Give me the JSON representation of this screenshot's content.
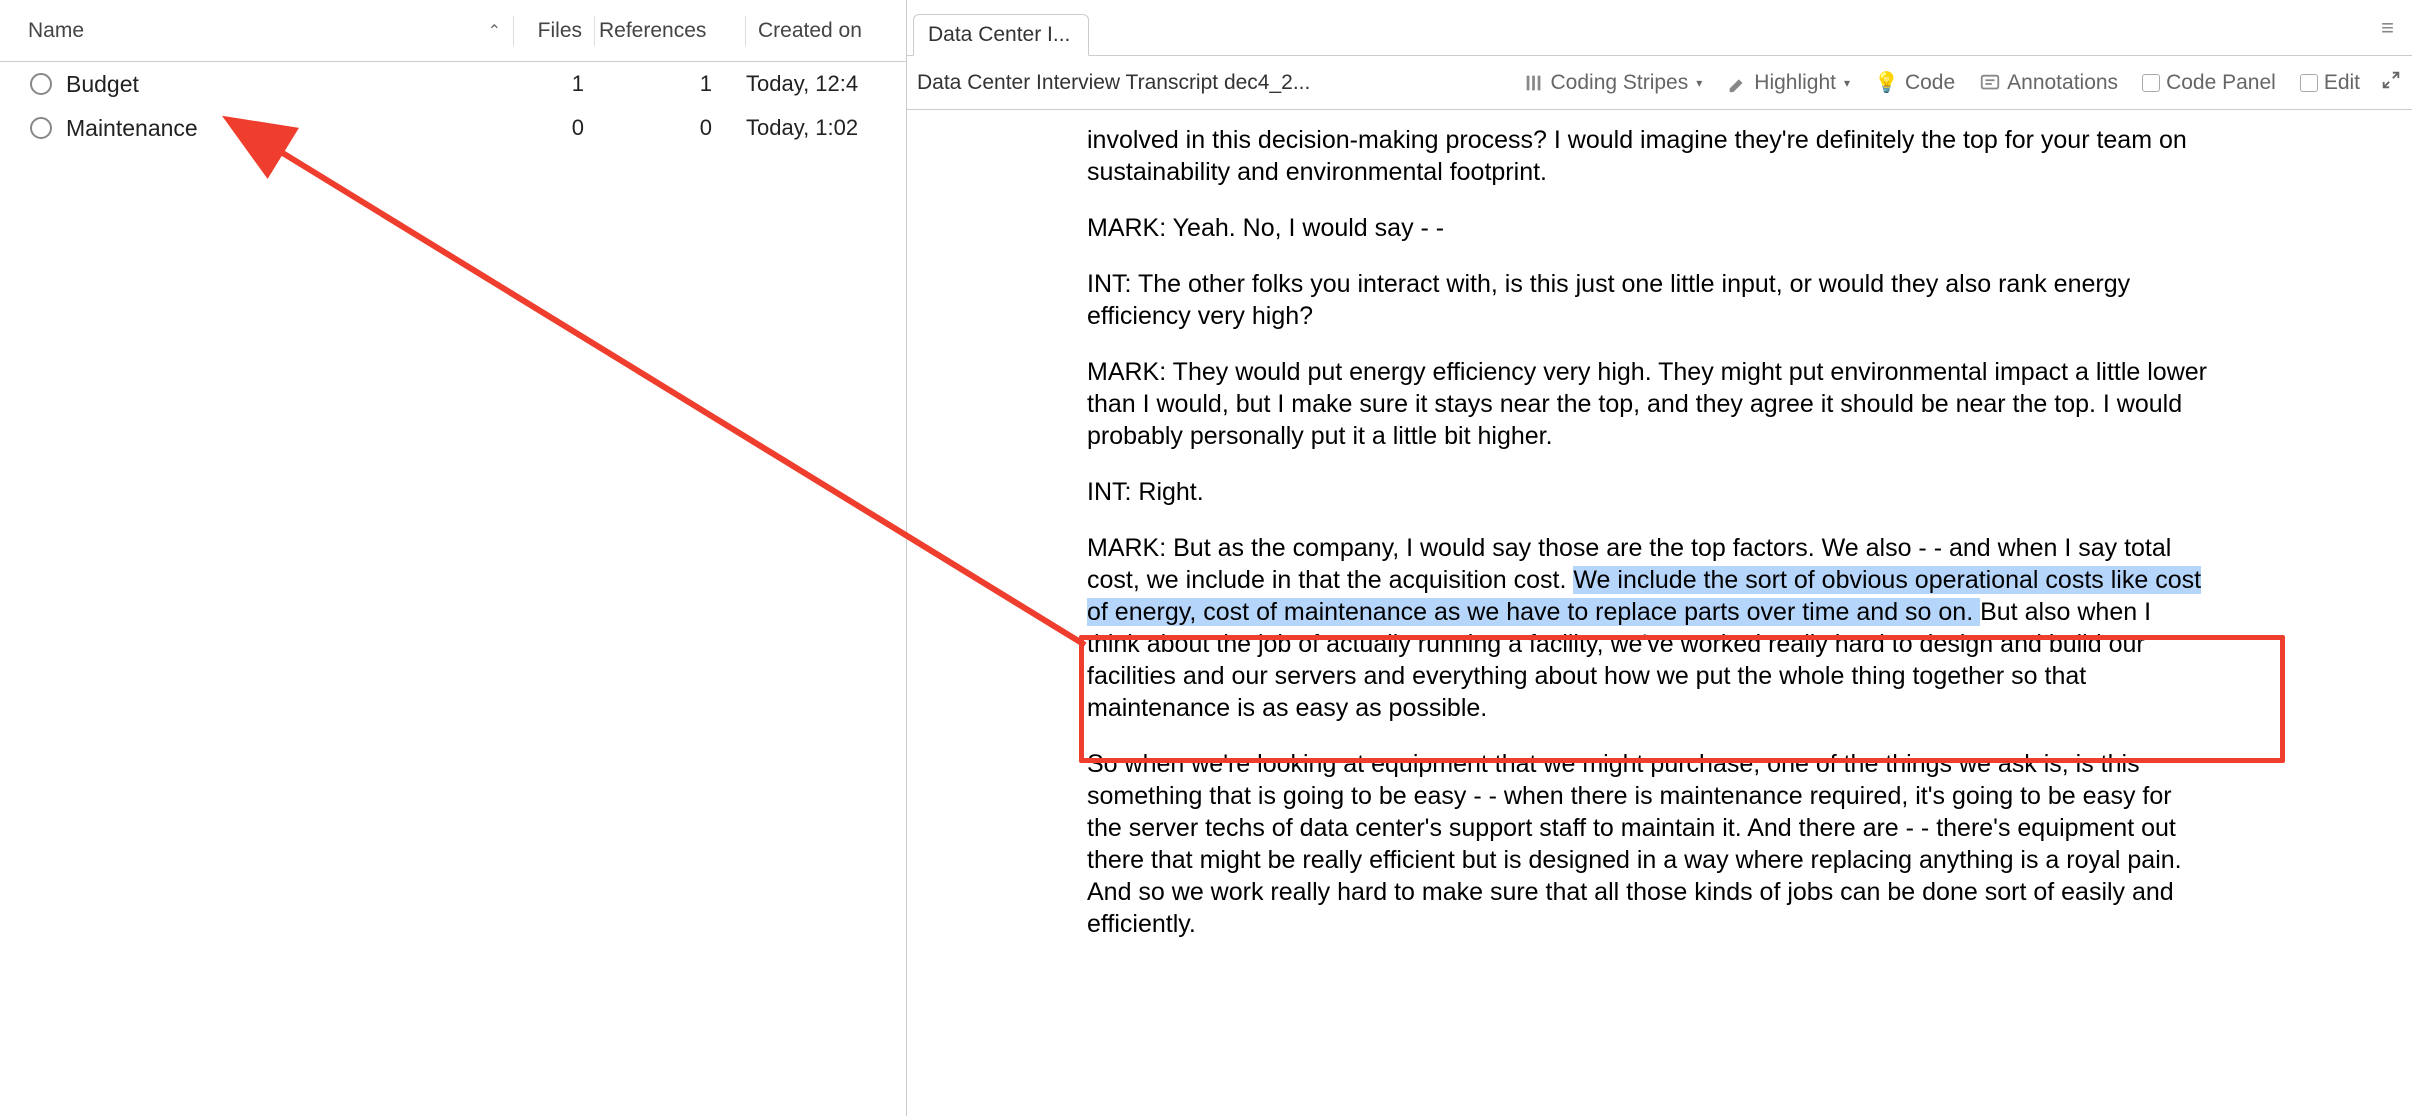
{
  "left": {
    "columns": {
      "name": "Name",
      "files": "Files",
      "refs": "References",
      "created": "Created on"
    },
    "rows": [
      {
        "name": "Budget",
        "files": "1",
        "refs": "1",
        "created": "Today, 12:4"
      },
      {
        "name": "Maintenance",
        "files": "0",
        "refs": "0",
        "created": "Today, 1:02"
      }
    ]
  },
  "right": {
    "tab_label": "Data Center I...",
    "doc_path": "Data Center Interview Transcript dec4_2...",
    "toolbar": {
      "coding_stripes": "Coding Stripes",
      "highlight": "Highlight",
      "code": "Code",
      "annotations": "Annotations",
      "code_panel": "Code Panel",
      "edit": "Edit"
    },
    "paras": {
      "p0": "involved in this decision-making process?  I would imagine they're definitely the top for your team on sustainability and environmental footprint.",
      "p1": "MARK:  Yeah.  No, I would say - -",
      "p2": "INT:  The other folks you interact with, is this just one little input, or would they also rank energy efficiency very high?",
      "p3": "MARK:  They would put energy efficiency very high.  They might put environmental impact a little lower than I would, but I make sure it stays near the top, and they agree it should be near the top.  I would probably personally put it a little bit higher.",
      "p4": "INT:  Right.",
      "p5_a": "MARK:  But as the company, I would say those are the top factors.  We also - - and when I say total cost, we include in that the acquisition cost.  ",
      "p5_sel": "We include the sort of obvious operational costs like cost of energy, cost of maintenance as we have to replace parts over time and so on.  ",
      "p5_b": "But also when I think about the job of actually running a facility, we've worked really hard to design and build our facilities and our servers and everything about how we put the whole thing together so that maintenance is as easy as possible.",
      "p6": "So when we're looking at equipment that we might purchase, one of the things we ask is, is this something that is going to be easy - - when there is maintenance required, it's going to be easy for the server techs of data center's support staff to maintain it.  And there are - - there's equipment out there that might be really efficient but is designed in a way where replacing anything is a royal pain.  And so we work really hard to make sure that all those kinds of jobs can be done sort of easily and efficiently."
    }
  }
}
